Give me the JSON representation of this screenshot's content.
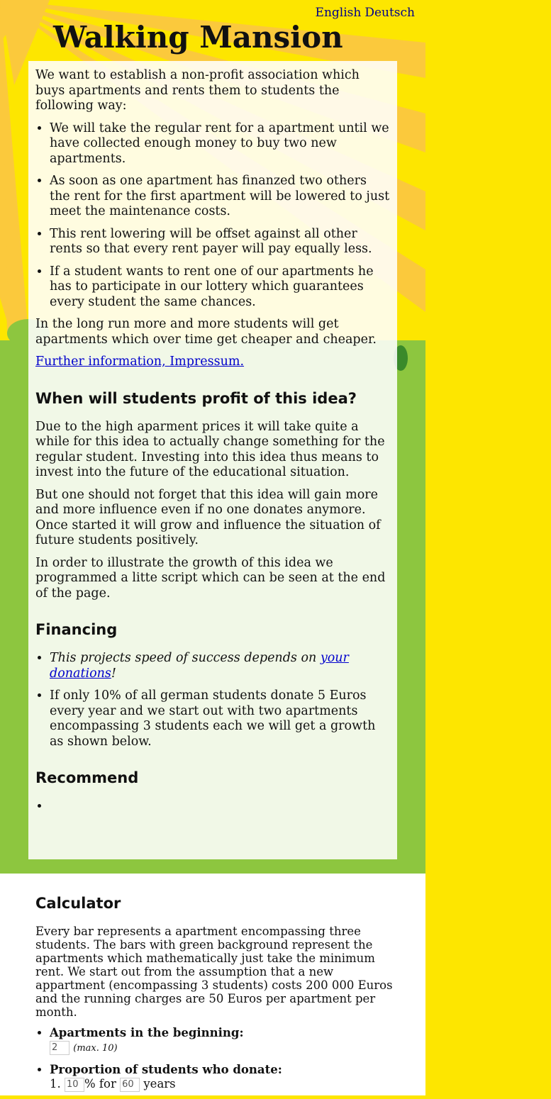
{
  "languages": [
    "English",
    "Deutsch"
  ],
  "title": "Walking Mansion",
  "intro": "We want to establish a non-profit association which buys apartments and rents them to students the following way:",
  "rules": [
    "We will take the regular rent for a apartment until we have collected enough money to buy two new apartments.",
    "As soon as one apartment has finanzed two others the rent for the first apartment will be lowered to just meet the maintenance costs.",
    "This rent lowering will be offset against all other rents so that every rent payer will pay equally less.",
    "If a student wants to rent one of our apartments he has to participate in our lottery which guarantees every student the same chances."
  ],
  "long_run": "In the long run more and more students will get apartments which over time get cheaper and cheaper.",
  "further_link": "Further information, Impressum.",
  "profit": {
    "heading": "When will students profit of this idea?",
    "paragraphs": [
      "Due to the high aparment prices it will take quite a while for this idea to actually change something for the regular student. Investing into this idea thus means to invest into the future of the educational situation.",
      "But one should not forget that this idea will gain more and more influence even if no one donates anymore. Once started it will grow and influence the situation of future students positively.",
      "In order to illustrate the growth of this idea we programmed a litte script which can be seen at the end of the page."
    ]
  },
  "financing": {
    "heading": "Financing",
    "item1_pre": "This projects speed of success depends on ",
    "item1_link": "your donations",
    "item1_post": "!",
    "item2": "If only 10% of all german students donate 5 Euros every year and we start out with two apartments encompassing 3 students each we will get a growth as shown below."
  },
  "recommend": {
    "heading": "Recommend"
  },
  "calculator": {
    "heading": "Calculator",
    "description": "Every bar represents a apartment encompassing three students. The bars with green background represent the apartments which mathematically just take the minimum rent. We start out from the assumption that a new appartment (encompassing 3 students) costs 200 000 Euros and the running charges are 50 Euros per apartment per month.",
    "apartments_label": "Apartments in the beginning:",
    "apartments_value": "2",
    "apartments_hint": "(max. 10)",
    "proportion_label": "Proportion of students who donate:",
    "row_number": "1.",
    "percent_value": "10",
    "percent_for": "% for",
    "years_value": "60",
    "years_label": "years"
  },
  "colors": {
    "sky": "#fde600",
    "grass": "#8dc63f",
    "ray": "#fbc93c"
  }
}
